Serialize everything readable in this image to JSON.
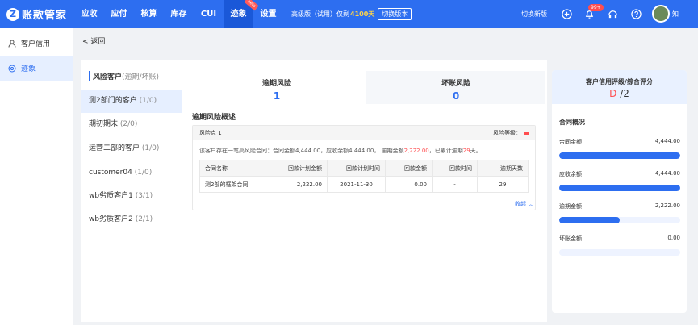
{
  "header": {
    "logo_mark": "Z",
    "logo_text": "账款管家",
    "nav": [
      {
        "label": "应收"
      },
      {
        "label": "应付"
      },
      {
        "label": "核算"
      },
      {
        "label": "库存"
      },
      {
        "label": "CUI"
      },
      {
        "label": "迹象",
        "badge": "beta"
      },
      {
        "label": "设置"
      }
    ],
    "edition_text": "高级版（试用）仅剩",
    "edition_days": "4100天",
    "switch_version": "切换版本",
    "switch_new": "切换新版",
    "notif_badge": "99+",
    "user_name": "知",
    "accent": "#2d6ef0"
  },
  "sidebar": {
    "items": [
      {
        "label": "客户信用",
        "icon": "user-icon"
      },
      {
        "label": "迹象",
        "icon": "radar-icon"
      }
    ]
  },
  "back_label": "< 返回",
  "customers": {
    "title": "风险客户",
    "subtitle": "(逾期/坏账)",
    "items": [
      {
        "name": "测2部门的客户",
        "count": "(1/0)"
      },
      {
        "name": "期初期末",
        "count": "(2/0)"
      },
      {
        "name": "运营二部的客户",
        "count": "(1/0)"
      },
      {
        "name": "customer04",
        "count": "(1/0)"
      },
      {
        "name": "wb劣质客户1",
        "count": "(3/1)"
      },
      {
        "name": "wb劣质客户2",
        "count": "(2/1)"
      }
    ]
  },
  "tabs": [
    {
      "label": "逾期风险",
      "value": "1"
    },
    {
      "label": "坏账风险",
      "value": "0"
    }
  ],
  "overview": {
    "title": "逾期风险概述",
    "risk_point": "风险点 1",
    "risk_level_label": "风险等级：",
    "desc_prefix": "该客户存在一笔高风险合同：合同金额4,444.00，应收余额4,444.00， 逾期金额",
    "desc_overdue": "2,222.00",
    "desc_mid": "，已累计逾期",
    "desc_days": "29",
    "desc_suffix": "天。",
    "table": {
      "headers": [
        "合同名称",
        "回款计划金额",
        "回款计划时间",
        "回款金额",
        "回款时间",
        "逾期天数"
      ],
      "rows": [
        [
          "测2部的框架合同",
          "2,222.00",
          "2021-11-30",
          "0.00",
          "-",
          "29"
        ]
      ]
    },
    "collapse_label": "收起 ︿"
  },
  "credit": {
    "title": "客户信用评级/综合评分",
    "grade": "D",
    "score": "/2",
    "section": "合同概况",
    "metrics": [
      {
        "label": "合同金额",
        "value": "4,444.00",
        "fraction": 1.0
      },
      {
        "label": "应收余额",
        "value": "4,444.00",
        "fraction": 1.0
      },
      {
        "label": "逾期金额",
        "value": "2,222.00",
        "fraction": 0.5
      },
      {
        "label": "坏账金额",
        "value": "0.00",
        "fraction": 0.0
      }
    ]
  }
}
